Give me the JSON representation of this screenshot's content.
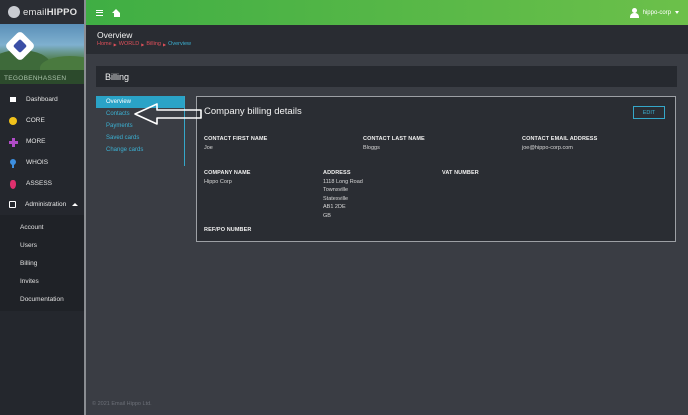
{
  "brand": {
    "name_light": "email",
    "name_bold": "HIPPO"
  },
  "banner_caption": "TEGOBENHASSEN",
  "sidebar": {
    "items": [
      {
        "label": "Dashboard",
        "icon": "dashboard-icon"
      },
      {
        "label": "CORE",
        "icon": "core-icon"
      },
      {
        "label": "MORE",
        "icon": "more-icon"
      },
      {
        "label": "WHOIS",
        "icon": "whois-icon"
      },
      {
        "label": "ASSESS",
        "icon": "assess-icon"
      },
      {
        "label": "Administration",
        "icon": "administration-icon"
      }
    ],
    "admin_sub": [
      "Account",
      "Users",
      "Billing",
      "Invites",
      "Documentation"
    ]
  },
  "topbar": {
    "user": "hippo-corp"
  },
  "header": {
    "title": "Overview",
    "breadcrumb": [
      "Home",
      "WORLD",
      "Billing",
      "Overview"
    ]
  },
  "billing": {
    "title": "Billing",
    "subnav": [
      "Overview",
      "Contacts",
      "Payments",
      "Saved cards",
      "Change cards"
    ],
    "active": "Overview"
  },
  "details": {
    "title": "Company billing details",
    "edit_label": "EDIT",
    "contact_first_name": {
      "label": "CONTACT FIRST NAME",
      "value": "Joe"
    },
    "contact_last_name": {
      "label": "CONTACT LAST NAME",
      "value": "Bloggs"
    },
    "contact_email": {
      "label": "CONTACT EMAIL ADDRESS",
      "value": "joe@hippo-corp.com"
    },
    "company_name": {
      "label": "COMPANY NAME",
      "value": "Hippo Corp"
    },
    "address": {
      "label": "ADDRESS",
      "lines": [
        "1118 Long Road",
        "Townsville",
        "Statesville",
        "AB1 2DE",
        "GB"
      ]
    },
    "vat_number": {
      "label": "VAT NUMBER",
      "value": ""
    },
    "ref_po": {
      "label": "REF/PO NUMBER",
      "value": ""
    }
  },
  "footer": "© 2021 Email Hippo Ltd.",
  "colors": {
    "accent": "#2aa3c7",
    "topbar_green": "#4cb246",
    "breadcrumb_red": "#e0505a"
  }
}
